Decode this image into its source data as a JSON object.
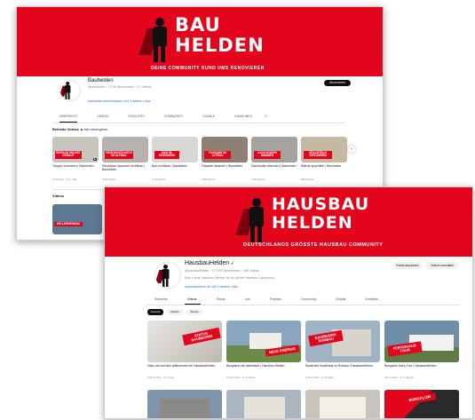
{
  "back": {
    "banner": {
      "logo_line1": "BAU",
      "logo_line2": "HELDEN",
      "tagline": "DEINE COMMUNITY RUND UMS RENOVIEREN"
    },
    "channel": {
      "name": "Bauhelden",
      "meta": "@bauhelden · 12,3K Abonnenten · 2,1 Videos",
      "link": "bauhelden.de/mitmachen und 3 weitere Links",
      "subscribe": "Abonnieren"
    },
    "tabs": [
      "ÜBERSICHT",
      "VIDEOS",
      "PLAYLISTS",
      "COMMUNITY",
      "KANÄLE",
      "KANALINFO"
    ],
    "section_title": "Beliebte Videos",
    "play_all": "Alle wiedergeben",
    "videos": [
      {
        "tag": "EINFACH SELBST GEBAUT",
        "title": "Treppe renovieren | Bauhelden",
        "meta": "41 Aufrufe · vor 1 Jahr",
        "thumb": "#c9c4bd"
      },
      {
        "tag": "HEIZUNGSTAUSCH IM ALTBAU",
        "title": "Heizkörper tauschen im Altbau | Bauhelden",
        "meta": "5,4K Aufrufe",
        "thumb": "#b7b2ad"
      },
      {
        "tag": "BAD IM EIGENHEIM",
        "title": "Bad im Altbau | Bauhelden",
        "meta": "2,1K Aufrufe",
        "thumb": "#d9d7d4"
      },
      {
        "tag": "FASSADE IM ALTBAU",
        "title": "Fassade dämmen | Bauhelden",
        "meta": "3,8K Aufrufe",
        "thumb": "#8f7f74"
      },
      {
        "tag": "DACH BODEN DÄMMEN",
        "title": "Dachboden dämmen | Bauhelden",
        "meta": "1,9K Aufrufe",
        "thumb": "#a6a39e"
      },
      {
        "tag": "SPACHTELN TAPEZIEREN",
        "title": "Wände spachteln | Bauhelden",
        "meta": "980 Aufrufe",
        "thumb": "#c6b9a3"
      }
    ],
    "section2_title": "Videos",
    "bottom_thumb_tag": "KELLERNEUBAU"
  },
  "front": {
    "banner": {
      "logo_line1": "HAUSBAU",
      "logo_line2": "HELDEN",
      "tagline": "DEUTSCHLANDS GRÖSSTE HAUSBAU COMMUNITY"
    },
    "channel": {
      "name": "HausbauHelden",
      "meta": "@hausbauhelden · 177.000 Abonnenten · 395 Videos",
      "desc": "Euer Kanal 'Hausbau Helden' ist die größte Hausbau-Community...",
      "link": "hausbauhelden.de und 3 weitere Links",
      "btn_manage": "Kanal anpassen",
      "btn_videos": "Videos verwalten"
    },
    "tabs": [
      "Startseite",
      "Videos",
      "Shorts",
      "Live",
      "Playlists",
      "Community",
      "Kanäle",
      "Kanalinfo"
    ],
    "chips": [
      "Neueste",
      "Beliebt",
      "Älteste"
    ],
    "videos": [
      {
        "tag": "STATUS BAUBEGINN",
        "title": "Hallo und herzlich willkommen bei HausbauHelden",
        "meta": "6,5K Aufrufe · vor 1 Tag",
        "thumb": "#d2cfca"
      },
      {
        "tag": "NEUE ENERGIE",
        "title": "Bungalow mit Satteldach | Hausbau Helden",
        "meta": "3,1K Aufrufe · vor 3 Tagen",
        "thumb": "#8aa5c0"
      },
      {
        "tag": "BAUBEGINN ROHBAU",
        "title": "Modernes Stadthaus im Rohbau | HausbauHelden",
        "meta": "4,2K Aufrufe · vor 5 Tagen",
        "thumb": "#9fb3c5"
      },
      {
        "tag": "FERTIGHAUS TOUR",
        "title": "Bungalow Haus-Tour | HausbauHelden",
        "meta": "12K Aufrufe · vor 1 Woche",
        "thumb": "#6f8fa9"
      }
    ],
    "row2": [
      {
        "tag": "",
        "thumb": "#7f95ab"
      },
      {
        "tag": "",
        "thumb": "#a9b6bf"
      },
      {
        "tag": "",
        "thumb": "#c8c4bd"
      },
      {
        "tag": "BUNGALOW",
        "thumb": "#3a3a3a"
      }
    ]
  }
}
